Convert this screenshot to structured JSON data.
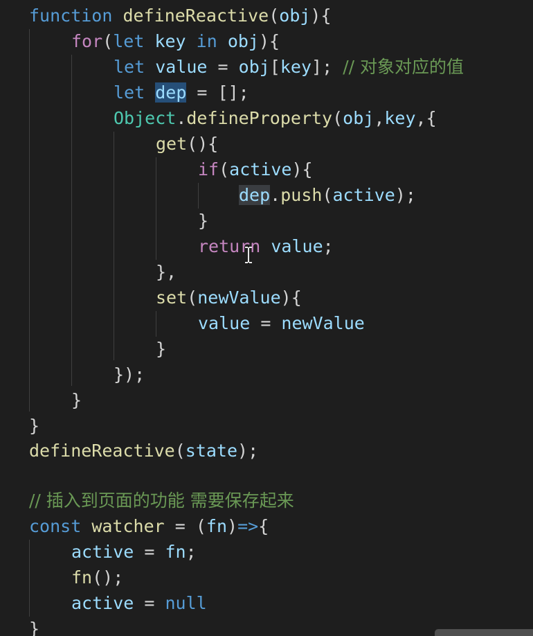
{
  "code": {
    "l1": {
      "kw": "function",
      "sp": " ",
      "name": "defineReactive",
      "open": "(",
      "param": "obj",
      "close": "){"
    },
    "l2": {
      "ctl": "for",
      "open": "(",
      "kw": "let",
      "sp1": " ",
      "var": "key",
      "sp2": " ",
      "in": "in",
      "sp3": " ",
      "obj": "obj",
      "close": "){"
    },
    "l3": {
      "kw": "let",
      "sp": " ",
      "var": "value",
      "eq": " = ",
      "obj": "obj",
      "lb": "[",
      "key": "key",
      "rb": "];",
      "sp2": " ",
      "comment": "// 对象对应的值"
    },
    "l4": {
      "kw": "let",
      "sp": " ",
      "var": "dep",
      "rest": " = [];"
    },
    "l5": {
      "cls": "Object",
      "dot": ".",
      "method": "defineProperty",
      "open": "(",
      "a1": "obj",
      "comma": ",",
      "a2": "key",
      "close": ",{"
    },
    "l6": {
      "method": "get",
      "rest": "(){"
    },
    "l7": {
      "ctl": "if",
      "open": "(",
      "var": "active",
      "close": "){"
    },
    "l8": {
      "var": "dep",
      "dot": ".",
      "method": "push",
      "open": "(",
      "arg": "active",
      "close": ");"
    },
    "l9": {
      "text": "}"
    },
    "l10": {
      "ctl": "return",
      "sp": " ",
      "var": "value",
      "end": ";"
    },
    "l11": {
      "text": "},"
    },
    "l12": {
      "method": "set",
      "open": "(",
      "param": "newValue",
      "close": "){"
    },
    "l13": {
      "var1": "value",
      "eq": " = ",
      "var2": "newValue"
    },
    "l14": {
      "text": "}"
    },
    "l15": {
      "text": "});"
    },
    "l16": {
      "text": "}"
    },
    "l17": {
      "text": "}"
    },
    "l18": {
      "fn": "defineReactive",
      "open": "(",
      "arg": "state",
      "close": ");"
    },
    "l20": {
      "comment": "// 插入到页面的功能 需要保存起来"
    },
    "l21": {
      "kw": "const",
      "sp": " ",
      "name": "watcher",
      "eq": " = ",
      "open": "(",
      "param": "fn",
      "close": ")",
      "arrow": "=>",
      "brace": "{"
    },
    "l22": {
      "var1": "active",
      "eq": " = ",
      "var2": "fn",
      "end": ";"
    },
    "l23": {
      "fn": "fn",
      "end": "();"
    },
    "l24": {
      "var": "active",
      "eq": " = ",
      "kw": "null"
    },
    "l25": {
      "text": "}"
    }
  },
  "colors": {
    "background": "#1e1e1e",
    "keyword": "#569cd6",
    "control": "#c586c0",
    "function": "#dcdcaa",
    "variable": "#9cdcfe",
    "class": "#4ec9b0",
    "comment": "#6a9955",
    "selection": "#264f78"
  },
  "icons": {
    "text_cursor": "i-beam-cursor-icon"
  }
}
